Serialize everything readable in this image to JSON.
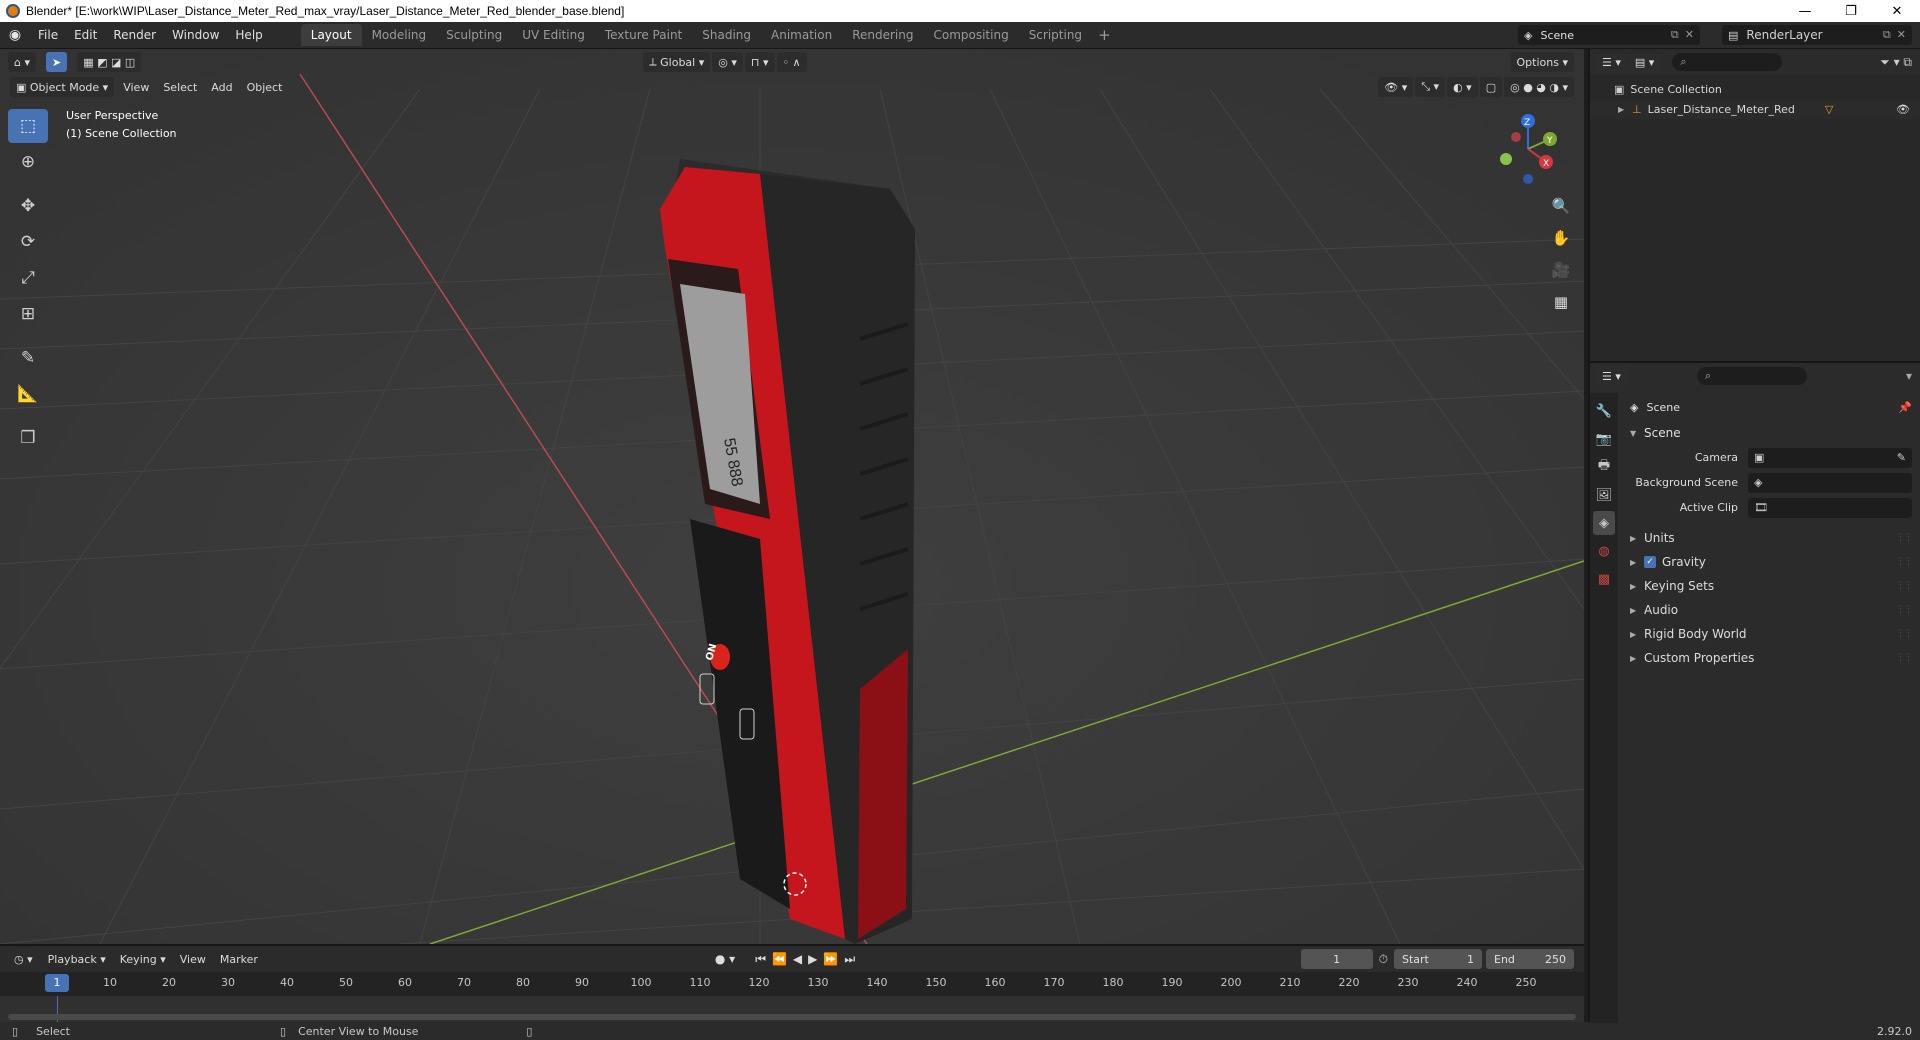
{
  "window": {
    "title": "Blender* [E:\\work\\WIP\\Laser_Distance_Meter_Red_max_vray/Laser_Distance_Meter_Red_blender_base.blend]",
    "minimize": "—",
    "maximize": "❐",
    "close": "✕"
  },
  "menu": [
    "File",
    "Edit",
    "Render",
    "Window",
    "Help"
  ],
  "workspaces": [
    "Layout",
    "Modeling",
    "Sculpting",
    "UV Editing",
    "Texture Paint",
    "Shading",
    "Animation",
    "Rendering",
    "Compositing",
    "Scripting"
  ],
  "workspace_add": "+",
  "scene_name": "Scene",
  "render_layer": "RenderLayer",
  "viewport": {
    "mode": "Object Mode",
    "menus": [
      "View",
      "Select",
      "Add",
      "Object"
    ],
    "orientation": "Global",
    "options": "Options",
    "perspective": "User Perspective",
    "collection": "(1) Scene Collection",
    "gizmo_axes": [
      "X",
      "Y",
      "Z"
    ]
  },
  "device": {
    "display_digits": "55 888",
    "on_label": "ON",
    "plus": "+",
    "minus": "−"
  },
  "timeline": {
    "menus": [
      "Playback",
      "Keying",
      "View",
      "Marker"
    ],
    "current_frame": "1",
    "start_label": "Start",
    "start": "1",
    "end_label": "End",
    "end": "250",
    "ticks": [
      "10",
      "20",
      "30",
      "40",
      "50",
      "60",
      "70",
      "80",
      "90",
      "100",
      "110",
      "120",
      "130",
      "140",
      "150",
      "160",
      "170",
      "180",
      "190",
      "200",
      "210",
      "220",
      "230",
      "240",
      "250"
    ]
  },
  "status": {
    "select": "Select",
    "center_view": "Center View to Mouse",
    "version": "2.92.0"
  },
  "outliner": {
    "root": "Scene Collection",
    "object": "Laser_Distance_Meter_Red"
  },
  "properties": {
    "context": "Scene",
    "panel": "Scene",
    "camera_label": "Camera",
    "background_label": "Background Scene",
    "clip_label": "Active Clip",
    "subpanels": [
      "Units",
      "Gravity",
      "Keying Sets",
      "Audio",
      "Rigid Body World",
      "Custom Properties"
    ]
  },
  "colors": {
    "accent": "#4772b3",
    "viewport_bg": "#393939",
    "x_axis": "#b84a52",
    "y_axis": "#7ea832",
    "device_red": "#c4161c"
  }
}
